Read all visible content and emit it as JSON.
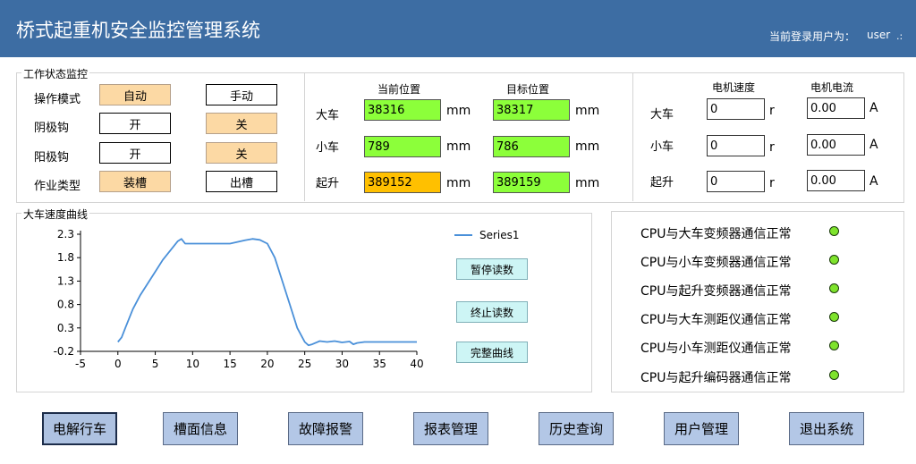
{
  "header": {
    "title": "桥式起重机安全监控管理系统",
    "user_label": "当前登录用户为：",
    "user_name": "user",
    "menu_glyph": ".:"
  },
  "work_status": {
    "legend": "工作状态监控",
    "rows": [
      {
        "label": "操作模式",
        "left": "自动",
        "right": "手动"
      },
      {
        "label": "阴极钩",
        "left": "开",
        "right": "关"
      },
      {
        "label": "阳极钩",
        "left": "开",
        "right": "关"
      },
      {
        "label": "作业类型",
        "left": "装槽",
        "right": "出槽"
      }
    ]
  },
  "position": {
    "current_header": "当前位置",
    "target_header": "目标位置",
    "unit": "mm",
    "rows": [
      {
        "label": "大车",
        "current": "38316",
        "target": "38317"
      },
      {
        "label": "小车",
        "current": "789",
        "target": "786"
      },
      {
        "label": "起升",
        "current": "389152",
        "target": "389159"
      }
    ]
  },
  "motor": {
    "speed_header": "电机速度",
    "current_header": "电机电流",
    "speed_unit": "r",
    "current_unit": "A",
    "rows": [
      {
        "label": "大车",
        "speed": "0",
        "current": "0.00"
      },
      {
        "label": "小车",
        "speed": "0",
        "current": "0.00"
      },
      {
        "label": "起升",
        "speed": "0",
        "current": "0.00"
      }
    ]
  },
  "chart_section": {
    "legend": "大车速度曲线",
    "buttons": {
      "pause": "暂停读数",
      "stop": "终止读数",
      "full": "完整曲线"
    }
  },
  "chart_data": {
    "type": "line",
    "title": "",
    "xlabel": "",
    "ylabel": "",
    "xlim": [
      -5,
      40
    ],
    "ylim": [
      -0.2,
      2.3
    ],
    "x_ticks": [
      "-5",
      "0",
      "5",
      "10",
      "15",
      "20",
      "25",
      "30",
      "35",
      "40"
    ],
    "y_ticks": [
      "2.3",
      "1.8",
      "1.3",
      "0.8",
      "0.3",
      "-0.2"
    ],
    "legend_position": "top-right",
    "series": [
      {
        "name": "Series1",
        "color": "#4a90d9",
        "x": [
          0,
          0.5,
          1,
          2,
          3,
          4,
          5,
          6,
          7,
          8,
          8.5,
          9,
          10,
          12,
          15,
          17,
          18,
          19,
          20,
          21,
          22,
          23,
          24,
          25,
          25.5,
          26,
          27,
          28,
          29,
          30,
          31,
          31.5,
          32,
          33,
          35,
          38,
          40
        ],
        "y": [
          0.0,
          0.1,
          0.3,
          0.7,
          1.0,
          1.25,
          1.5,
          1.75,
          1.95,
          2.15,
          2.2,
          2.1,
          2.1,
          2.1,
          2.1,
          2.17,
          2.2,
          2.18,
          2.1,
          1.8,
          1.3,
          0.8,
          0.3,
          0.0,
          -0.07,
          -0.05,
          0.02,
          0.0,
          0.02,
          -0.01,
          0.01,
          -0.05,
          -0.02,
          0.0,
          0.0,
          0.0,
          0.0
        ]
      }
    ]
  },
  "comm_status": [
    "CPU与大车变频器通信正常",
    "CPU与小车变频器通信正常",
    "CPU与起升变频器通信正常",
    "CPU与大车测距仪通信正常",
    "CPU与小车测距仪通信正常",
    "CPU与起升编码器通信正常"
  ],
  "comm_led_color": "#7ee32c",
  "nav_buttons": [
    "电解行车",
    "槽面信息",
    "故障报警",
    "报表管理",
    "历史查询",
    "用户管理",
    "退出系统"
  ]
}
